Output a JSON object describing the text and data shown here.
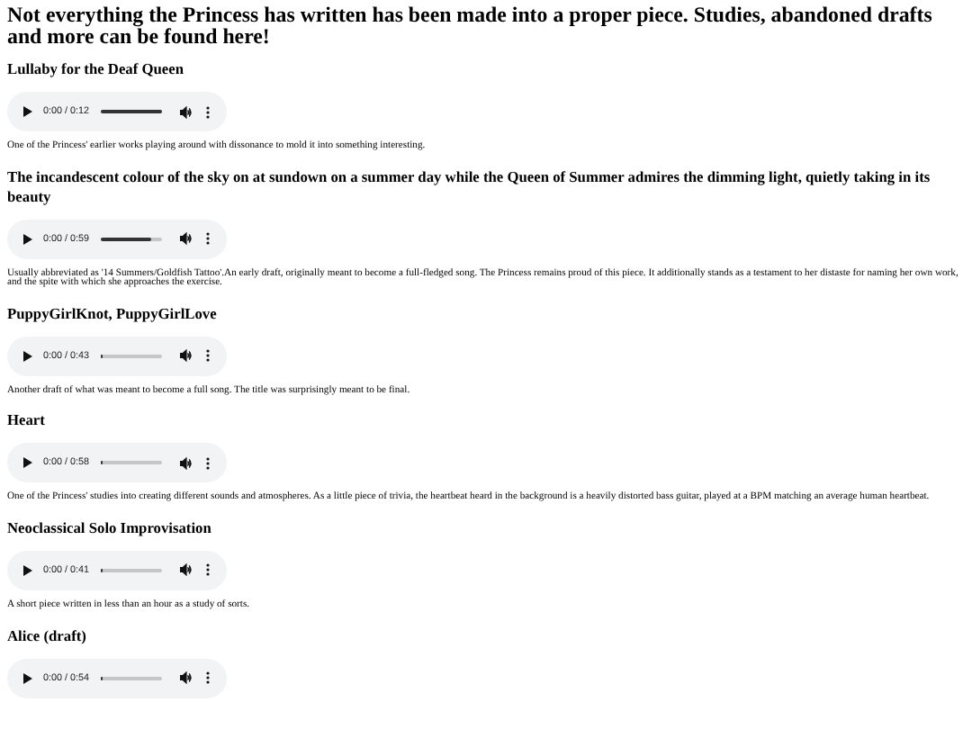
{
  "heading": "Not everything the Princess has written has been made into a proper piece. Studies, abandoned drafts and more can be found here!",
  "tracks": [
    {
      "title": "Lullaby for the Deaf Queen",
      "player": {
        "time": "0:00 / 0:12",
        "level": 1
      },
      "description": "One of the Princess' earlier works playing around with dissonance to mold it into something interesting."
    },
    {
      "title": "The incandescent colour of the sky on at sundown on a summer day while the Queen of Summer admires the dimming light, quietly taking in its beauty",
      "player": {
        "time": "0:00 / 0:59",
        "level": 0.8
      },
      "description": "Usually abbreviated as '14 Summers/Goldfish Tattoo'.An early draft, originally meant to become a full-fledged song. The Princess remains proud of this piece. It additionally stands as a testament to her distaste for naming her own work, and the spite with which she approaches the exercise."
    },
    {
      "title": "PuppyGirlKnot, PuppyGirlLove",
      "player": {
        "time": "0:00 / 0:43",
        "level": 0.02
      },
      "description": "Another draft of what was meant to become a full song. The title was surprisingly meant to be final."
    },
    {
      "title": "Heart",
      "player": {
        "time": "0:00 / 0:58",
        "level": 0.02
      },
      "description": "One of the Princess' studies into creating different sounds and atmospheres. As a little piece of trivia, the heartbeat heard in the background is a heavily distorted bass guitar, played at a BPM matching an average human heartbeat."
    },
    {
      "title": "Neoclassical Solo Improvisation",
      "player": {
        "time": "0:00 / 0:41",
        "level": 0.02
      },
      "description": "A short piece written in less than an hour as a study of sorts."
    },
    {
      "title": "Alice (draft)",
      "player": {
        "time": "0:00 / 0:54",
        "level": 0.02
      }
    }
  ]
}
